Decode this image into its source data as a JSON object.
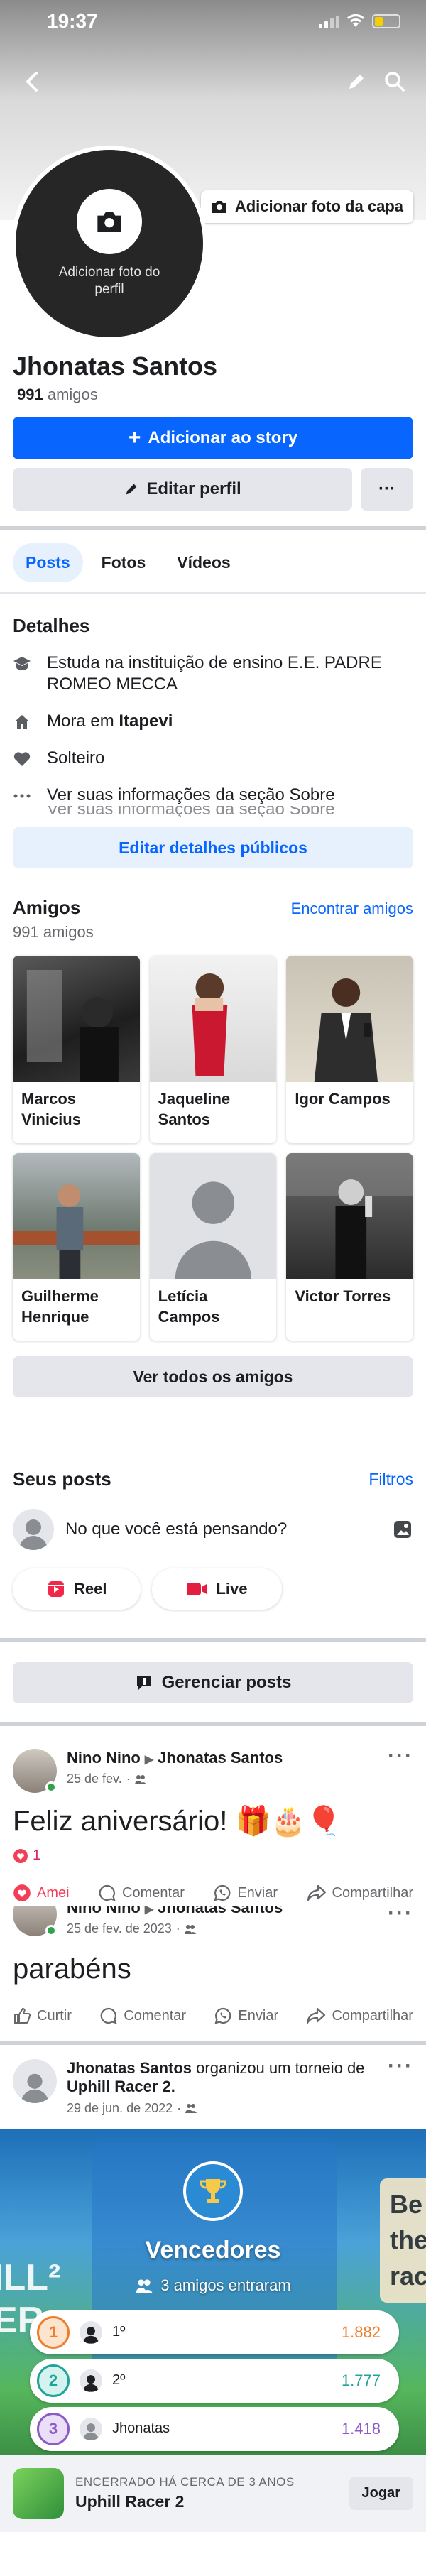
{
  "status_bar": {
    "time": "19:37"
  },
  "cover": {
    "add_cover_label": "Adicionar foto da capa"
  },
  "avatar": {
    "add_label": "Adicionar foto do perfil"
  },
  "profile": {
    "name": "Jhonatas Santos",
    "friends_number": "991",
    "friends_word": "amigos"
  },
  "buttons": {
    "add_story": "Adicionar ao story",
    "edit_profile": "Editar perfil",
    "more": "···"
  },
  "tabs": [
    {
      "label": "Posts",
      "active": true
    },
    {
      "label": "Fotos",
      "active": false
    },
    {
      "label": "Vídeos",
      "active": false
    }
  ],
  "details": {
    "title": "Detalhes",
    "education": "Estuda na instituição de ensino E.E. PADRE ROMEO MECCA",
    "lives_prefix": "Mora em ",
    "lives_city": "Itapevi",
    "relationship": "Solteiro",
    "about": "Ver suas informações da seção Sobre",
    "edit_button": "Editar detalhes públicos"
  },
  "friends": {
    "title": "Amigos",
    "count": "991 amigos",
    "find_link": "Encontrar amigos",
    "list": [
      {
        "name": "Marcos Vinicius"
      },
      {
        "name": "Jaqueline Santos"
      },
      {
        "name": "Igor Campos"
      },
      {
        "name": "Guilherme Henrique"
      },
      {
        "name": "Letícia Campos"
      },
      {
        "name": "Victor Torres"
      }
    ],
    "see_all": "Ver todos os amigos"
  },
  "your_posts": {
    "title": "Seus posts",
    "filters": "Filtros",
    "composer_placeholder": "No que você está pensando?",
    "reel": "Reel",
    "live": "Live",
    "manage": "Gerenciar posts"
  },
  "post1": {
    "author": "Nino Nino",
    "target": "Jhonatas Santos",
    "date": "25 de fev.",
    "text": "Feliz aniversário! 🎁🎂🎈",
    "reaction_count": "1",
    "actions": {
      "like": "Amei",
      "comment": "Comentar",
      "send": "Enviar",
      "share": "Compartilhar"
    }
  },
  "post2": {
    "author": "Nino Nino",
    "target": "Jhonatas Santos",
    "date": "25 de fev. de 2023",
    "text": "parabéns",
    "actions": {
      "like": "Curtir",
      "comment": "Comentar",
      "send": "Enviar",
      "share": "Compartilhar"
    }
  },
  "post3": {
    "author": "Jhonatas Santos",
    "action_text": " organizou um torneio de ",
    "game": "Uphill Racer 2.",
    "date": "29 de jun. de 2022",
    "winners_title": "Vencedores",
    "entered": "3 amigos entraram",
    "rankings": [
      {
        "rank": "1",
        "label": "1º",
        "score": "1.882",
        "color": "#f07d2a"
      },
      {
        "rank": "2",
        "label": "2º",
        "score": "1.777",
        "color": "#1fa39a"
      },
      {
        "rank": "3",
        "label": "Jhonatas",
        "score": "1.418",
        "color": "#8b5cc7"
      }
    ],
    "footer_small": "ENCERRADO HÁ CERCA DE 3 ANOS",
    "footer_title": "Uphill Racer 2",
    "play": "Jogar"
  }
}
